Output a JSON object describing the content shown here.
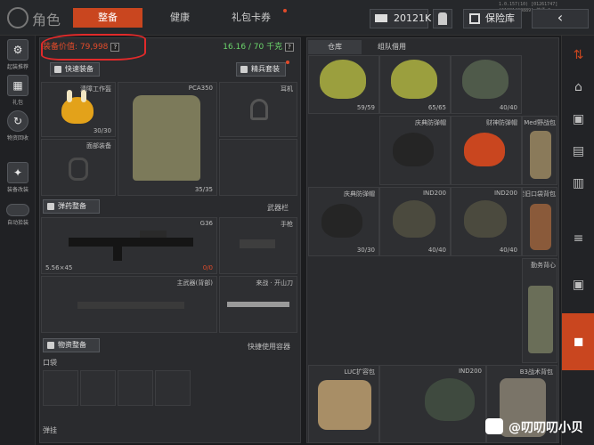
{
  "header": {
    "title": "角色",
    "version": "1.0.157(10) [01261747] [61881420889] 普通-2",
    "tabs": [
      {
        "label": "整备",
        "active": true
      },
      {
        "label": "健康",
        "active": false
      },
      {
        "label": "礼包卡券",
        "active": false
      }
    ],
    "currency": "20121K",
    "vault_label": "保险库"
  },
  "sidebar": {
    "items": [
      {
        "label": "起装推荐",
        "icon": "gear-icon"
      },
      {
        "label": "礼包",
        "icon": "gift-icon"
      },
      {
        "label": "物资回收",
        "icon": "recycle-icon"
      },
      {
        "label": "装备改装",
        "icon": "tools-icon"
      },
      {
        "label": "自动拾装",
        "icon": "toggle-icon"
      }
    ]
  },
  "loadout": {
    "value_label": "装备价值:",
    "value": "79,998",
    "weight": "16.16 / 70 千克",
    "quick_equip_label": "快速装备",
    "elite_set_label": "精兵套装",
    "slots": {
      "helmet": {
        "label": "清障工作盔",
        "count": "30/30"
      },
      "armor": {
        "label": "PCA350",
        "count": "35/35"
      },
      "earpiece": {
        "label": "耳机"
      },
      "face": {
        "label": "面部装备"
      }
    },
    "ammo_label": "弹药整备",
    "weapon_bar_label": "武器栏",
    "primary": {
      "label": "G36",
      "ammo": "5.56×45",
      "count": "0/0"
    },
    "pistol_label": "手枪",
    "primary2_label": "主武器(背部)",
    "melee_label": "来战 · 开山刀",
    "supply_label": "物资整备",
    "quick_container_label": "快捷使用容器",
    "pocket_label": "口袋",
    "vest_label": "弹挂"
  },
  "inventory": {
    "tabs": [
      {
        "label": "仓库",
        "active": true
      },
      {
        "label": "组队借用",
        "active": false
      }
    ],
    "items": [
      {
        "label": "",
        "count": "59/59"
      },
      {
        "label": "",
        "count": "65/65"
      },
      {
        "label": "",
        "count": "40/40"
      },
      {
        "label": "庆典防弹帽",
        "count": ""
      },
      {
        "label": "财神防弹帽",
        "count": ""
      },
      {
        "label": "Med野战包",
        "count": ""
      },
      {
        "label": "庆典防弹帽",
        "count": "30/30"
      },
      {
        "label": "IND200",
        "count": "40/40"
      },
      {
        "label": "IND200",
        "count": "40/40"
      },
      {
        "label": "老旧口袋背包",
        "count": ""
      },
      {
        "label": "勤务背心",
        "count": ""
      },
      {
        "label": "LUC扩容包",
        "count": ""
      },
      {
        "label": "IND200",
        "count": ""
      },
      {
        "label": "B3战术背包",
        "count": ""
      }
    ]
  },
  "watermark": "@叨叨叨小贝",
  "colors": {
    "accent": "#c9461f",
    "value": "#e24b2a",
    "weight": "#6cd66c"
  }
}
